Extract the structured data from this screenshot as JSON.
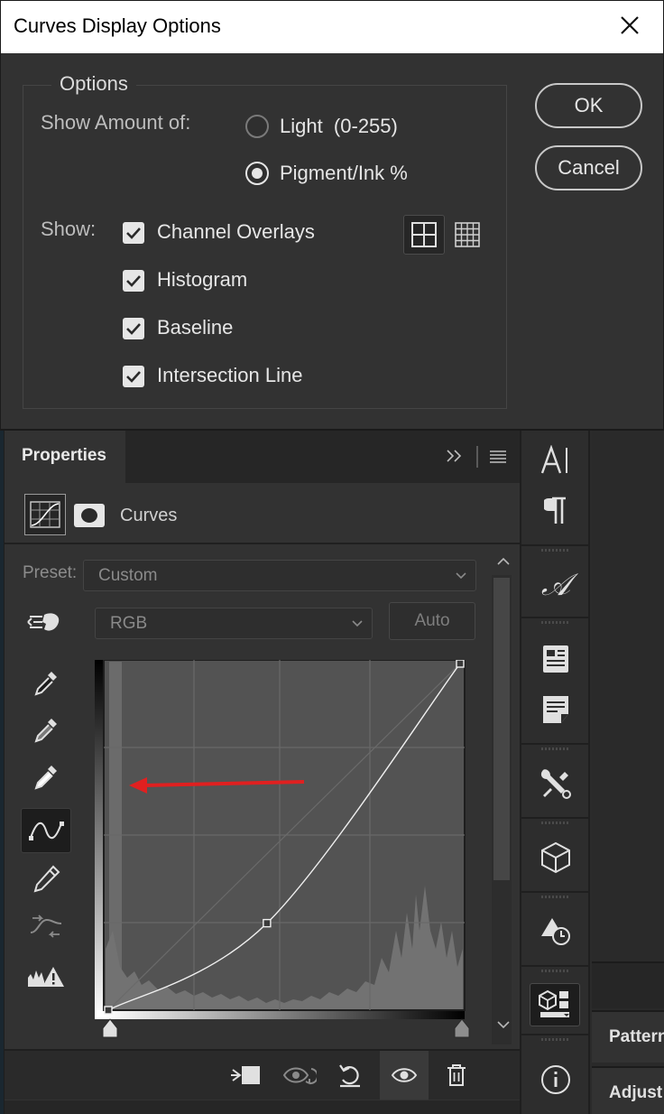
{
  "dialog": {
    "title": "Curves Display Options",
    "legend": "Options",
    "show_amount_label": "Show Amount of:",
    "radio_light": "Light  (0-255)",
    "radio_pigment": "Pigment/Ink %",
    "selected_radio": "Pigment/Ink %",
    "show_label": "Show:",
    "checkboxes": [
      {
        "label": "Channel Overlays",
        "checked": true
      },
      {
        "label": "Histogram",
        "checked": true
      },
      {
        "label": "Baseline",
        "checked": true
      },
      {
        "label": "Intersection Line",
        "checked": true
      }
    ],
    "ok": "OK",
    "cancel": "Cancel",
    "grid_options": [
      "simple-grid-icon",
      "detailed-grid-icon"
    ]
  },
  "properties": {
    "tab": "Properties",
    "adjustment_label": "Curves",
    "preset_label": "Preset:",
    "preset_value": "Custom",
    "channel_value": "RGB",
    "auto_label": "Auto",
    "tools": [
      "on-image-adjust-icon",
      "black-point-eyedropper-icon",
      "gray-point-eyedropper-icon",
      "white-point-eyedropper-icon",
      "curve-points-icon",
      "pencil-icon",
      "smooth-icon",
      "clipping-warning-icon"
    ],
    "curve_points": [
      [
        0,
        0
      ],
      [
        115,
        64
      ],
      [
        255,
        255
      ]
    ],
    "bottom_icons": [
      "clip-to-layer-icon",
      "view-previous-icon",
      "reset-icon",
      "visibility-icon",
      "trash-icon"
    ]
  },
  "right_strip": {
    "icons": [
      "character-icon",
      "paragraph-icon",
      "glyphs-icon",
      "paragraph-styles-icon",
      "notes-icon",
      "tool-presets-icon",
      "3d-icon",
      "history-icon",
      "libraries-icon",
      "info-icon"
    ]
  },
  "side_panels": {
    "patterns": "Pattern",
    "adjustments": "Adjust"
  },
  "colors": {
    "annotation_arrow": "#e02020",
    "panel_bg": "#323232",
    "title_bar": "#ffffff"
  }
}
